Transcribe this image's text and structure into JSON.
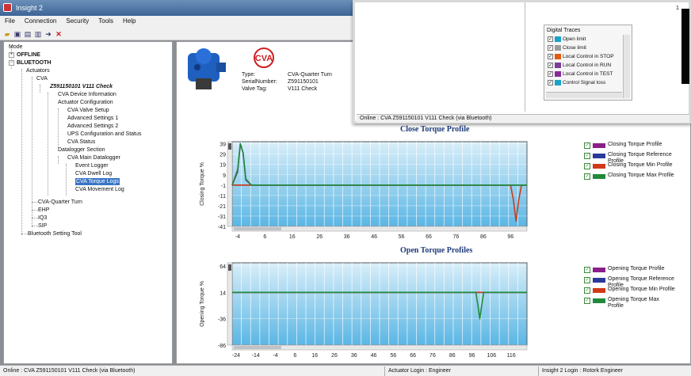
{
  "window": {
    "title": "Insight 2"
  },
  "menu": [
    "File",
    "Connection",
    "Security",
    "Tools",
    "Help"
  ],
  "tree": {
    "mode": "Mode",
    "offline": "OFFLINE",
    "bluetooth": "BLUETOOTH",
    "actuators": "Actuators",
    "cva": "CVA",
    "device": "Z591150101 V111 Check",
    "device_information": "CVA Device Information",
    "actuator_configuration": "Actuator Configuration",
    "valve_setup": "CVA Valve Setup",
    "advanced1": "Advanced Settings 1",
    "advanced2": "Advanced Settings 2",
    "ups": "UPS Configuration and Status",
    "cva_status": "CVA Status",
    "datalogger_section": "Datalogger Section",
    "main_datalogger": "CVA Main Datalogger",
    "event_logger": "Event Logger",
    "dwell_log": "CVA Dwell Log",
    "torque_logs": "CVA Torque Logs",
    "movement_log": "CVA Movement Log",
    "cva_quarter_turn": "CVA-Quarter Turn",
    "ehp": "EHP",
    "iq3": "IQ3",
    "sip": "SIP",
    "bluetooth_tool": "Bluetooth Setting Tool"
  },
  "device_header": {
    "type_label": "Type:",
    "type_value": "CVA-Quarter Turn",
    "serial_label": "SerialNumber:",
    "serial_value": "Z591150101",
    "tag_label": "Valve Tag:",
    "tag_value": "V111 Check",
    "logo_text": "CVA"
  },
  "popup": {
    "status": "Online : CVA Z591150101 V111 Check (via Bluetooth)",
    "digital_traces": {
      "title": "Digital Traces",
      "items": [
        {
          "label": "Open limit",
          "color": "#19a3c8",
          "checked": true
        },
        {
          "label": "Close limit",
          "color": "#9c9c9c",
          "checked": true
        },
        {
          "label": "Local Control in STOP",
          "color": "#e05a10",
          "checked": true
        },
        {
          "label": "Local Control in RUN",
          "color": "#7a3d9a",
          "checked": true
        },
        {
          "label": "Local Control in TEST",
          "color": "#8a2a9a",
          "checked": true
        },
        {
          "label": "Control Signal loss",
          "color": "#19a3c8",
          "checked": true
        }
      ]
    },
    "right_tick": "1"
  },
  "chart_data": [
    {
      "type": "line",
      "title": "Close Torque Profile",
      "ylabel": "Closing Torque %",
      "xlabel": "",
      "xlim": [
        -6,
        102
      ],
      "ylim": [
        -41,
        41
      ],
      "xticks": [
        -4,
        6,
        16,
        26,
        36,
        46,
        56,
        66,
        76,
        86,
        96
      ],
      "yticks": [
        39,
        29,
        19,
        9,
        -1,
        -11,
        -21,
        -31,
        -41
      ],
      "grid": true,
      "legend": "right",
      "series": [
        {
          "name": "Closing Torque Profile",
          "color": "#8a1e8a",
          "checked": true,
          "x": [
            -6,
            -4,
            -3,
            -2,
            -1,
            1,
            6,
            16,
            26,
            36,
            46,
            56,
            66,
            76,
            86,
            95,
            98,
            102
          ],
          "y": [
            -1,
            12,
            39,
            30,
            4,
            -1,
            -1,
            -1,
            -1,
            -1,
            -1,
            -1,
            -1,
            -1,
            -1,
            -1,
            -1,
            -1
          ]
        },
        {
          "name": "Closing Torque Reference Profile",
          "color": "#2a3a9a",
          "checked": true,
          "x": [
            -6,
            102
          ],
          "y": [
            -1,
            -1
          ]
        },
        {
          "name": "Closing Torque Min Profile",
          "color": "#d03a18",
          "checked": true,
          "x": [
            -6,
            6,
            16,
            26,
            36,
            46,
            56,
            66,
            76,
            86,
            96,
            97,
            98,
            99,
            100,
            102
          ],
          "y": [
            -1,
            -1,
            -1,
            -1,
            -1,
            -1,
            -1,
            -1,
            -1,
            -1,
            -1,
            -15,
            -36,
            -15,
            -1,
            -1
          ]
        },
        {
          "name": "Closing Torque Max Profile",
          "color": "#1f8a3a",
          "checked": true,
          "x": [
            -6,
            -4,
            -3,
            -2,
            -1,
            1,
            6,
            16,
            26,
            36,
            46,
            56,
            66,
            76,
            86,
            95,
            102
          ],
          "y": [
            -1,
            14,
            39,
            30,
            5,
            -1,
            -1,
            -1,
            -1,
            -1,
            -1,
            -1,
            -1,
            -1,
            -1,
            -1,
            -1
          ]
        }
      ]
    },
    {
      "type": "line",
      "title": "Open Torque Profiles",
      "ylabel": "Opening Torque %",
      "xlabel": "",
      "xlim": [
        -26,
        124
      ],
      "ylim": [
        -86,
        70
      ],
      "xticks": [
        -24,
        -14,
        -4,
        6,
        16,
        26,
        36,
        46,
        56,
        66,
        76,
        86,
        96,
        106,
        116
      ],
      "yticks": [
        64,
        14,
        -36,
        -86
      ],
      "grid": true,
      "legend": "right",
      "series": [
        {
          "name": "Opening Torque Profile",
          "color": "#8a1e8a",
          "checked": true,
          "x": [
            -26,
            124
          ],
          "y": [
            14,
            14
          ]
        },
        {
          "name": "Opening Torque Reference Profile",
          "color": "#2a3a9a",
          "checked": true,
          "x": [
            -26,
            124
          ],
          "y": [
            14,
            14
          ]
        },
        {
          "name": "Opening Torque Min Profile",
          "color": "#d03a18",
          "checked": true,
          "x": [
            -26,
            124
          ],
          "y": [
            14,
            14
          ]
        },
        {
          "name": "Opening Torque Max Profile",
          "color": "#1f8a3a",
          "checked": true,
          "x": [
            -26,
            98,
            99,
            100,
            101,
            102,
            124
          ],
          "y": [
            14,
            14,
            -10,
            -36,
            -10,
            14,
            14
          ]
        }
      ]
    }
  ],
  "statusbar": {
    "connection": "Online : CVA Z591150101 V111 Check (via Bluetooth)",
    "actuator_login": "Actuator Login : Engineer",
    "app_login": "Insight 2 Login : Rotork Engineer"
  }
}
